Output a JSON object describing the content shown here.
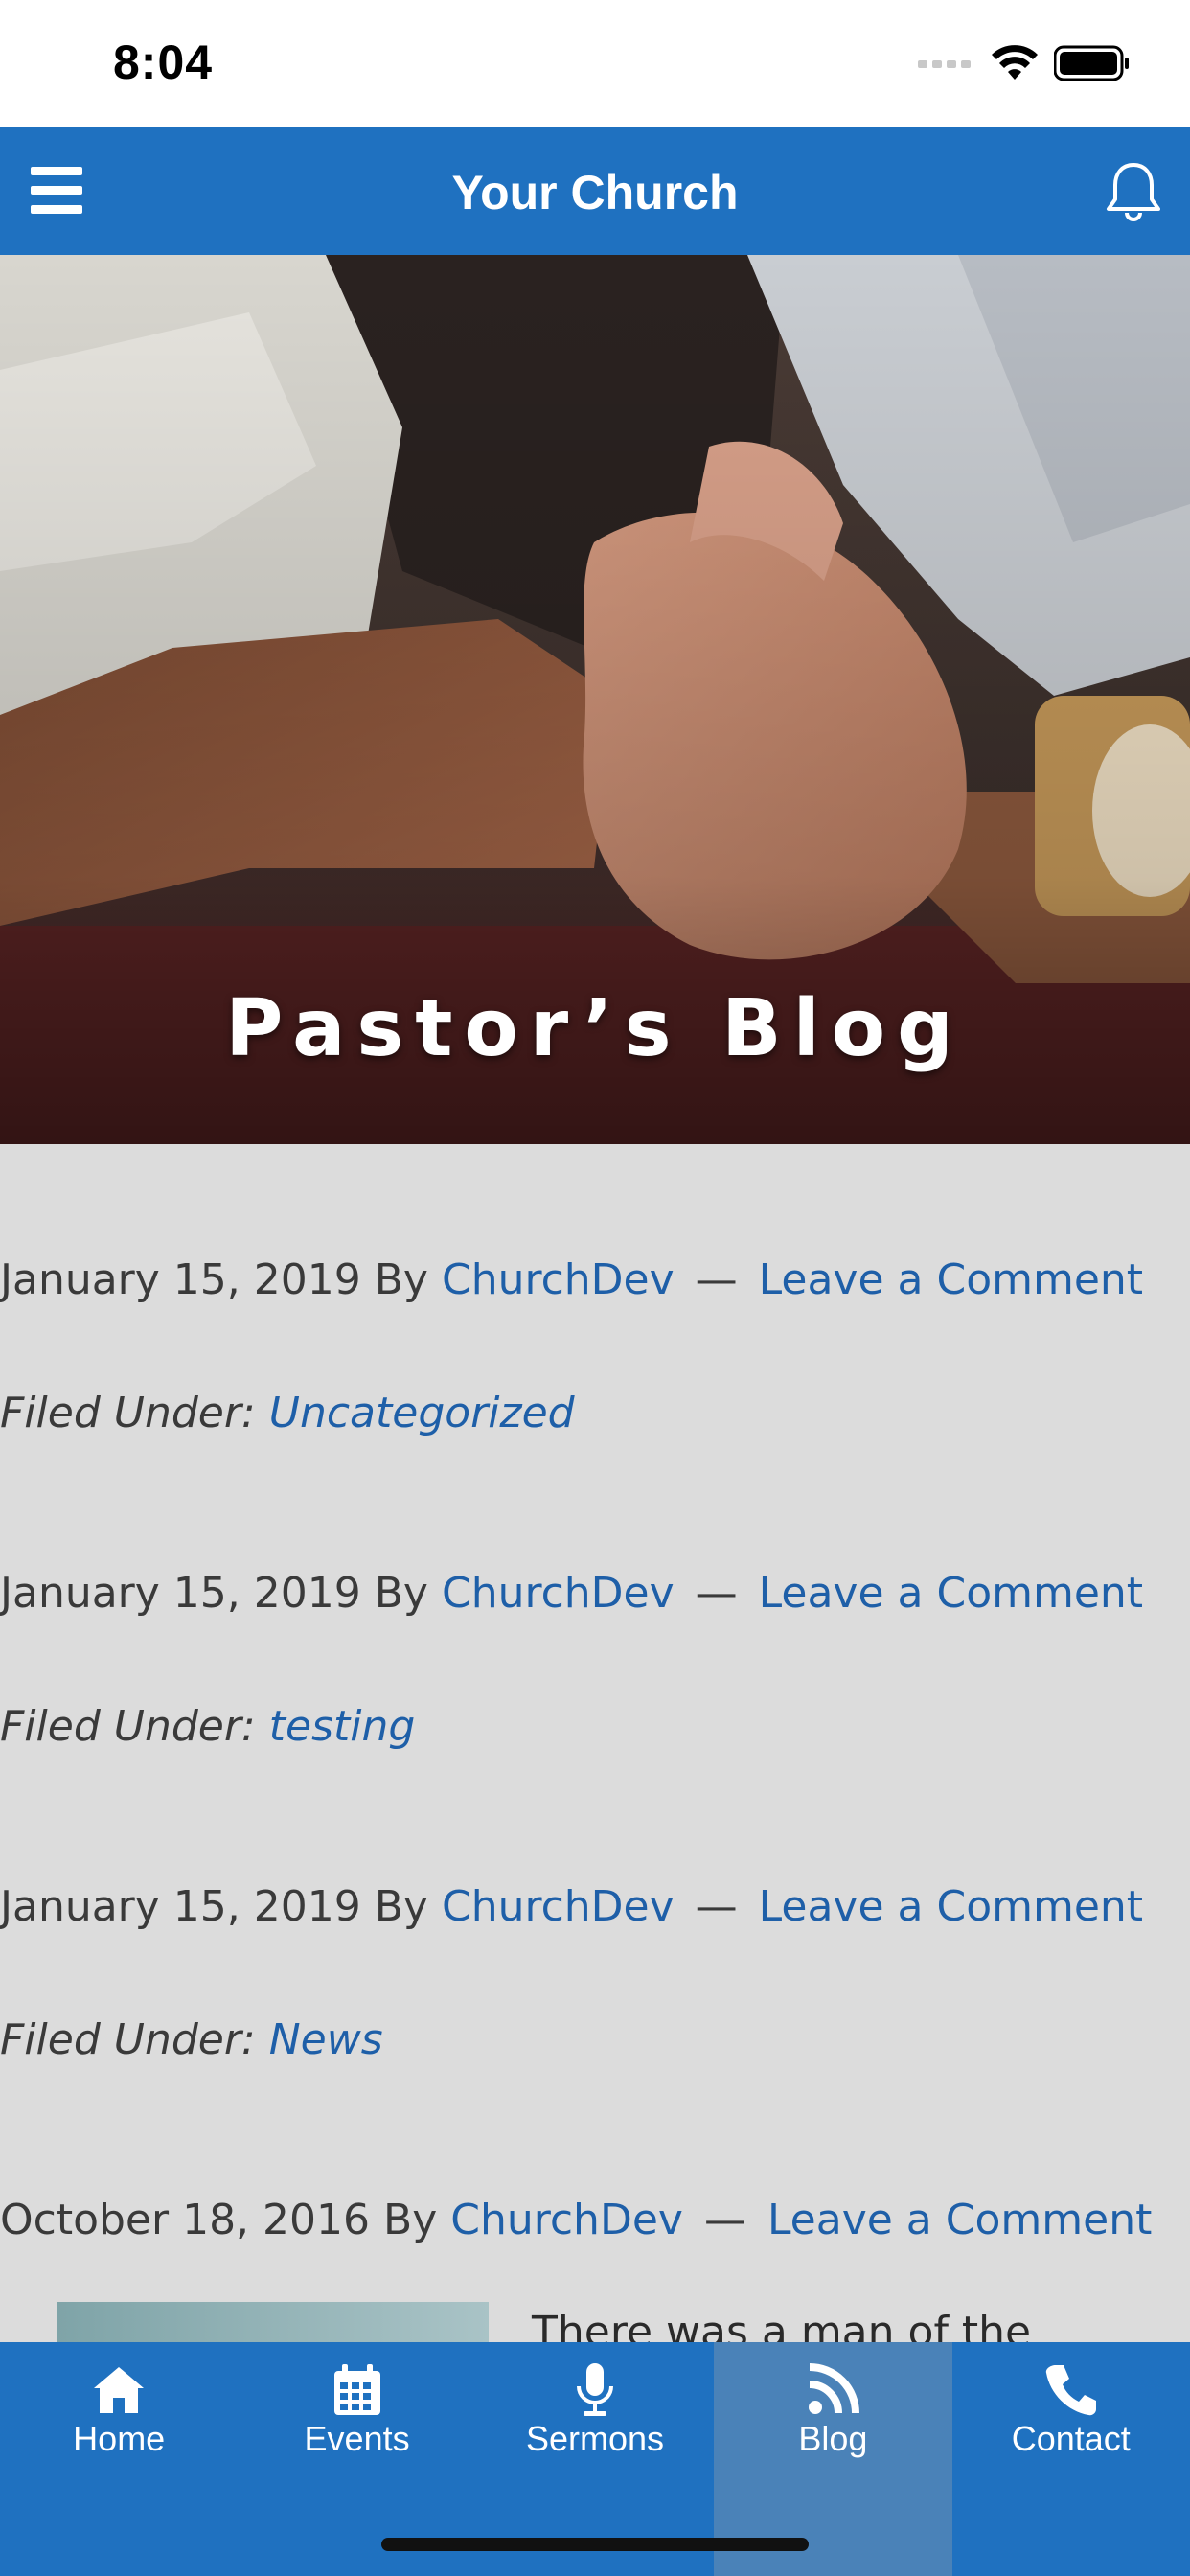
{
  "status_bar": {
    "time": "8:04"
  },
  "header": {
    "title": "Your Church"
  },
  "hero": {
    "title": "Pastor’s Blog"
  },
  "posts": [
    {
      "date": "January 15, 2019",
      "by": "By",
      "author": "ChurchDev",
      "comment_link": "Leave a Comment",
      "filed_label": "Filed Under:",
      "category": "Uncategorized"
    },
    {
      "date": "January 15, 2019",
      "by": "By",
      "author": "ChurchDev",
      "comment_link": "Leave a Comment",
      "filed_label": "Filed Under:",
      "category": "testing"
    },
    {
      "date": "January 15, 2019",
      "by": "By",
      "author": "ChurchDev",
      "comment_link": "Leave a Comment",
      "filed_label": "Filed Under:",
      "category": "News"
    },
    {
      "date": "October 18, 2016",
      "by": "By",
      "author": "ChurchDev",
      "comment_link": "Leave a Comment",
      "excerpt": "There was a man of the"
    }
  ],
  "tabs": [
    {
      "label": "Home",
      "icon": "home-icon"
    },
    {
      "label": "Events",
      "icon": "calendar-icon"
    },
    {
      "label": "Sermons",
      "icon": "microphone-icon"
    },
    {
      "label": "Blog",
      "icon": "rss-icon",
      "active": true
    },
    {
      "label": "Contact",
      "icon": "phone-icon"
    }
  ],
  "colors": {
    "brand": "#1f71c0",
    "link": "#1e5fa8",
    "content_bg": "#dcdcdc",
    "active_tab": "#4a82b8"
  }
}
